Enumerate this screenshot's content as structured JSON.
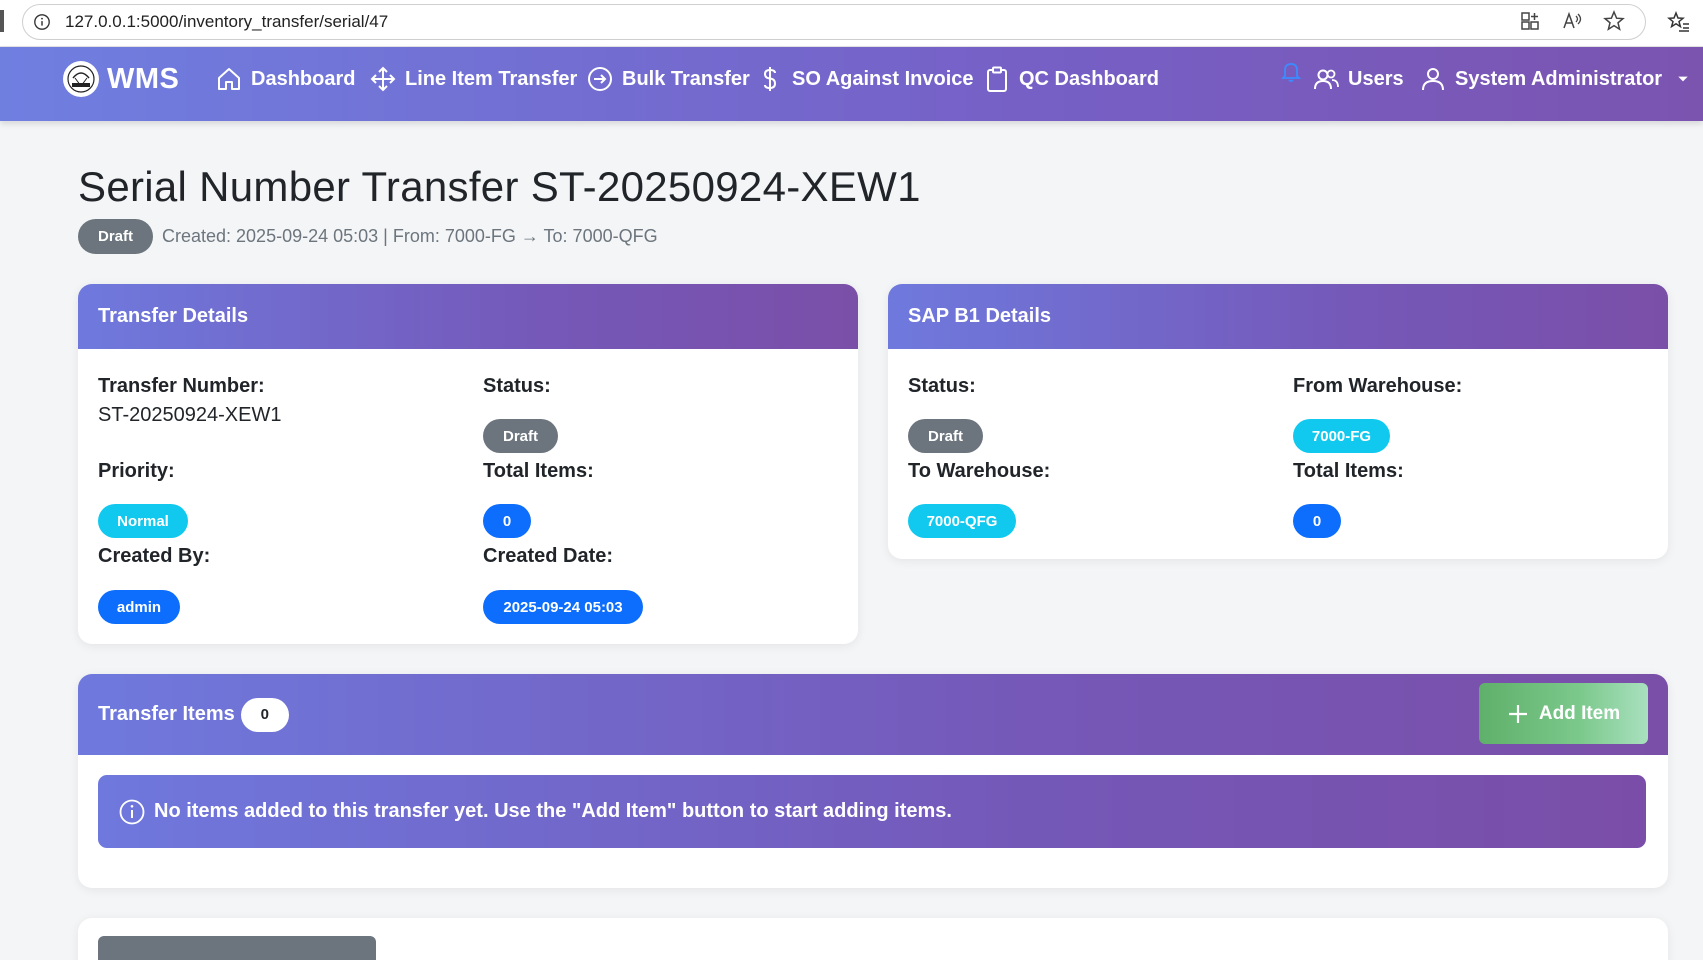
{
  "browser": {
    "url": "127.0.0.1:5000/inventory_transfer/serial/47"
  },
  "navbar": {
    "brand": "WMS",
    "items": [
      {
        "label": "Dashboard",
        "icon": "house-icon"
      },
      {
        "label": "Line Item Transfer",
        "icon": "arrows-move-icon"
      },
      {
        "label": "Bulk Transfer",
        "icon": "arrow-right-circle-icon"
      },
      {
        "label": "SO Against Invoice",
        "icon": "dollar-icon"
      },
      {
        "label": "QC Dashboard",
        "icon": "clipboard-icon"
      }
    ],
    "users_label": "Users",
    "user_label": "System Administrator"
  },
  "page": {
    "title": "Serial Number Transfer ST-20250924-XEW1",
    "status_badge": "Draft",
    "subtitle": "Created: 2025-09-24 05:03 | From: 7000-FG → To: 7000-QFG"
  },
  "transfer_details": {
    "header": "Transfer Details",
    "transfer_number_label": "Transfer Number:",
    "transfer_number": "ST-20250924-XEW1",
    "status_label": "Status:",
    "status": "Draft",
    "priority_label": "Priority:",
    "priority": "Normal",
    "total_items_label": "Total Items:",
    "total_items": "0",
    "created_by_label": "Created By:",
    "created_by": "admin",
    "created_date_label": "Created Date:",
    "created_date": "2025-09-24 05:03"
  },
  "sap_details": {
    "header": "SAP B1 Details",
    "status_label": "Status:",
    "status": "Draft",
    "from_warehouse_label": "From Warehouse:",
    "from_warehouse": "7000-FG",
    "to_warehouse_label": "To Warehouse:",
    "to_warehouse": "7000-QFG",
    "total_items_label": "Total Items:",
    "total_items": "0"
  },
  "transfer_items": {
    "header": "Transfer Items",
    "count": "0",
    "add_button": "Add Item",
    "empty_message": "No items added to this transfer yet. Use the \"Add Item\" button to start adding items."
  },
  "colors": {
    "nav_gradient_start": "#6f7fe0",
    "nav_gradient_end": "#7b54b0",
    "draft": "#6c757d",
    "cyan": "#11c9ee",
    "blue": "#0d6efd",
    "success": "#5fb06a"
  }
}
